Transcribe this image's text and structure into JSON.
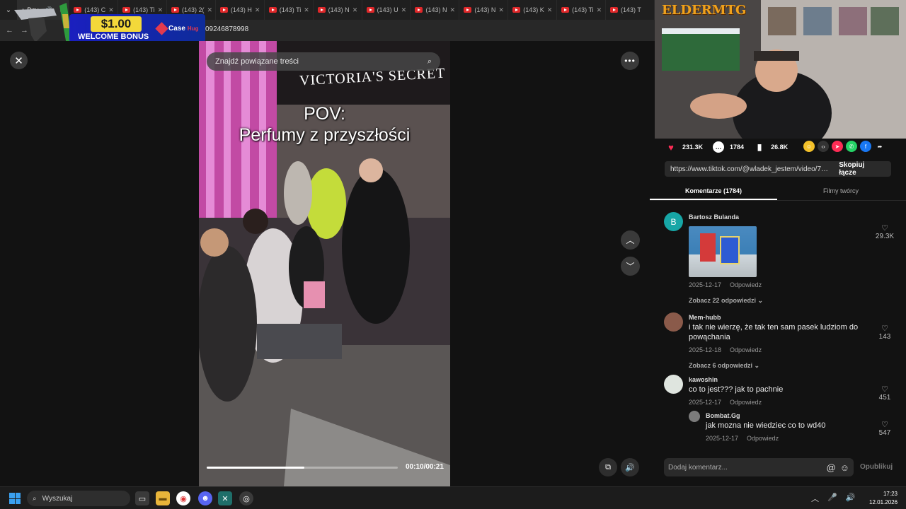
{
  "browser": {
    "tabs": [
      {
        "label": "Dav",
        "active": true
      },
      {
        "label": "(143) C"
      },
      {
        "label": "(143) Ti"
      },
      {
        "label": "(143) 2("
      },
      {
        "label": "(143) H"
      },
      {
        "label": "(143) Ti"
      },
      {
        "label": "(143) N"
      },
      {
        "label": "(143) U"
      },
      {
        "label": "(143) N"
      },
      {
        "label": "(143) N"
      },
      {
        "label": "(143) K"
      },
      {
        "label": "(143) Ti"
      },
      {
        "label": "(143) T"
      }
    ],
    "url_fragment": "09246878998"
  },
  "ad": {
    "price": "$1.00",
    "text": "WELCOME BONUS",
    "brand_a": "Case",
    "brand_b": "Hug"
  },
  "video": {
    "search_placeholder": "Znajdź powiązane treści",
    "caption_line1": "POV:",
    "caption_line2": "Perfumy z przyszłości",
    "store_sign": "VICTORIA'S SECRET",
    "time": "00:10/00:21",
    "progress": 0.51
  },
  "streamer": {
    "name": "ELDERMTG"
  },
  "stats": {
    "likes": "231.3K",
    "comments": "1784",
    "saves": "26.8K"
  },
  "share": {
    "url": "https://www.tiktok.com/@wladek_jestem/video/75...",
    "copy_label": "Skopiuj łącze"
  },
  "tabs": {
    "comments": "Komentarze (1784)",
    "creator": "Filmy twórcy"
  },
  "comments": [
    {
      "author": "Bartosz Bulanda",
      "avatar": "B",
      "date": "2025-12-17",
      "reply": "Odpowiedz",
      "likes": "29.3K",
      "replies": "Zobacz 22 odpowiedzi"
    },
    {
      "author": "Mem-hubb",
      "text": "i tak nie wierzę, że tak ten sam pasek ludziom do powąchania",
      "date": "2025-12-18",
      "reply": "Odpowiedz",
      "likes": "143",
      "replies": "Zobacz 6 odpowiedzi"
    },
    {
      "author": "kawoshin",
      "text": "co to jest??? jak to pachnie",
      "date": "2025-12-17",
      "reply": "Odpowiedz",
      "likes": "451"
    },
    {
      "author": "Bombat.Gg",
      "text": "jak mozna nie wiedziec co to wd40",
      "date": "2025-12-17",
      "reply": "Odpowiedz",
      "likes": "547"
    }
  ],
  "comment_input": {
    "placeholder": "Dodaj komentarz...",
    "publish": "Opublikuj"
  },
  "taskbar": {
    "search": "Wyszukaj",
    "time": "17:23",
    "date": "12.01.2026"
  }
}
